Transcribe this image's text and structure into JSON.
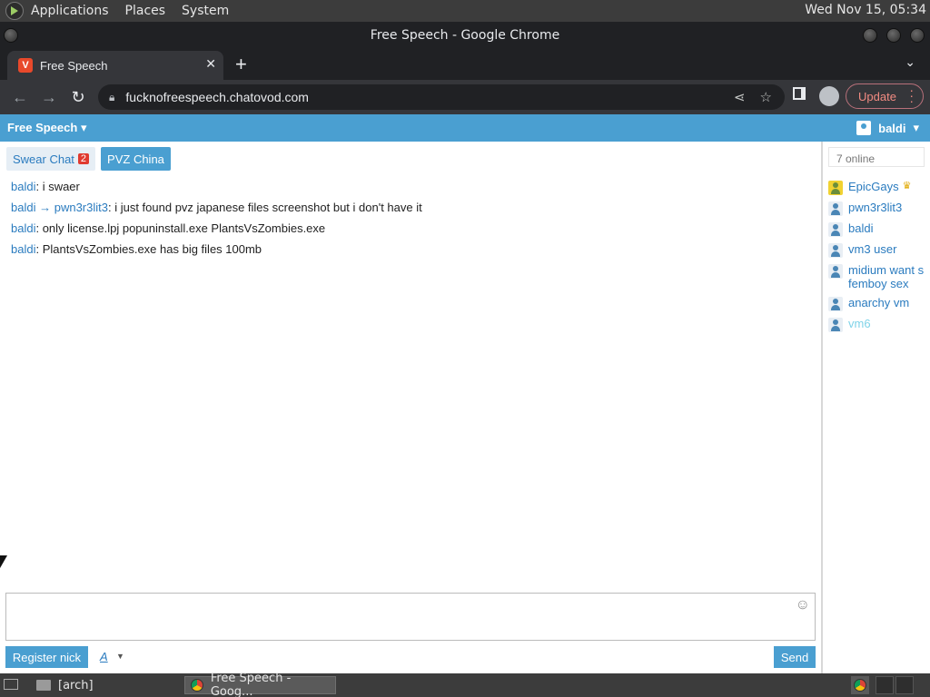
{
  "top_panel": {
    "menus": [
      "Applications",
      "Places",
      "System"
    ],
    "clock": "Wed Nov 15, 05:34"
  },
  "window": {
    "title": "Free Speech - Google Chrome"
  },
  "browser": {
    "tab_title": "Free Speech",
    "url": "fucknofreespeech.chatovod.com",
    "update_label": "Update"
  },
  "page": {
    "room_name": "Free Speech",
    "current_user": "baldi",
    "tabs": [
      {
        "label": "Swear Chat",
        "badge": "2"
      },
      {
        "label": "PVZ China"
      }
    ],
    "messages": [
      {
        "from": "baldi",
        "to": "",
        "text": ": i swaer"
      },
      {
        "from": "baldi",
        "to": "pwn3r3lit3",
        "text": ": i just found pvz japanese files screenshot but i don't have it"
      },
      {
        "from": "baldi",
        "to": "",
        "text": ": only license.lpj popuninstall.exe PlantsVsZombies.exe"
      },
      {
        "from": "baldi",
        "to": "",
        "text": ": PlantsVsZombies.exe has big files 100mb"
      }
    ],
    "online_count": "7 online",
    "users": [
      {
        "name": "EpicGays",
        "icon": "user-gold-icon"
      },
      {
        "name": "pwn3r3lit3",
        "icon": "user-icon"
      },
      {
        "name": "baldi",
        "icon": "user-icon"
      },
      {
        "name": "vm3 user",
        "icon": "user-icon"
      },
      {
        "name": "midium want s femboy sex",
        "icon": "user-icon"
      },
      {
        "name": "anarchy vm",
        "icon": "user-icon"
      },
      {
        "name": "vm6",
        "icon": "user-icon"
      }
    ],
    "register_label": "Register nick",
    "font_label": "A",
    "send_label": "Send"
  },
  "taskbar": {
    "items": [
      "[arch]",
      "Free Speech - Goog..."
    ]
  },
  "colors": {
    "accent": "#4a9fd1",
    "link": "#2a7bbf",
    "badge": "#e03a2f",
    "update": "#f28b82"
  }
}
